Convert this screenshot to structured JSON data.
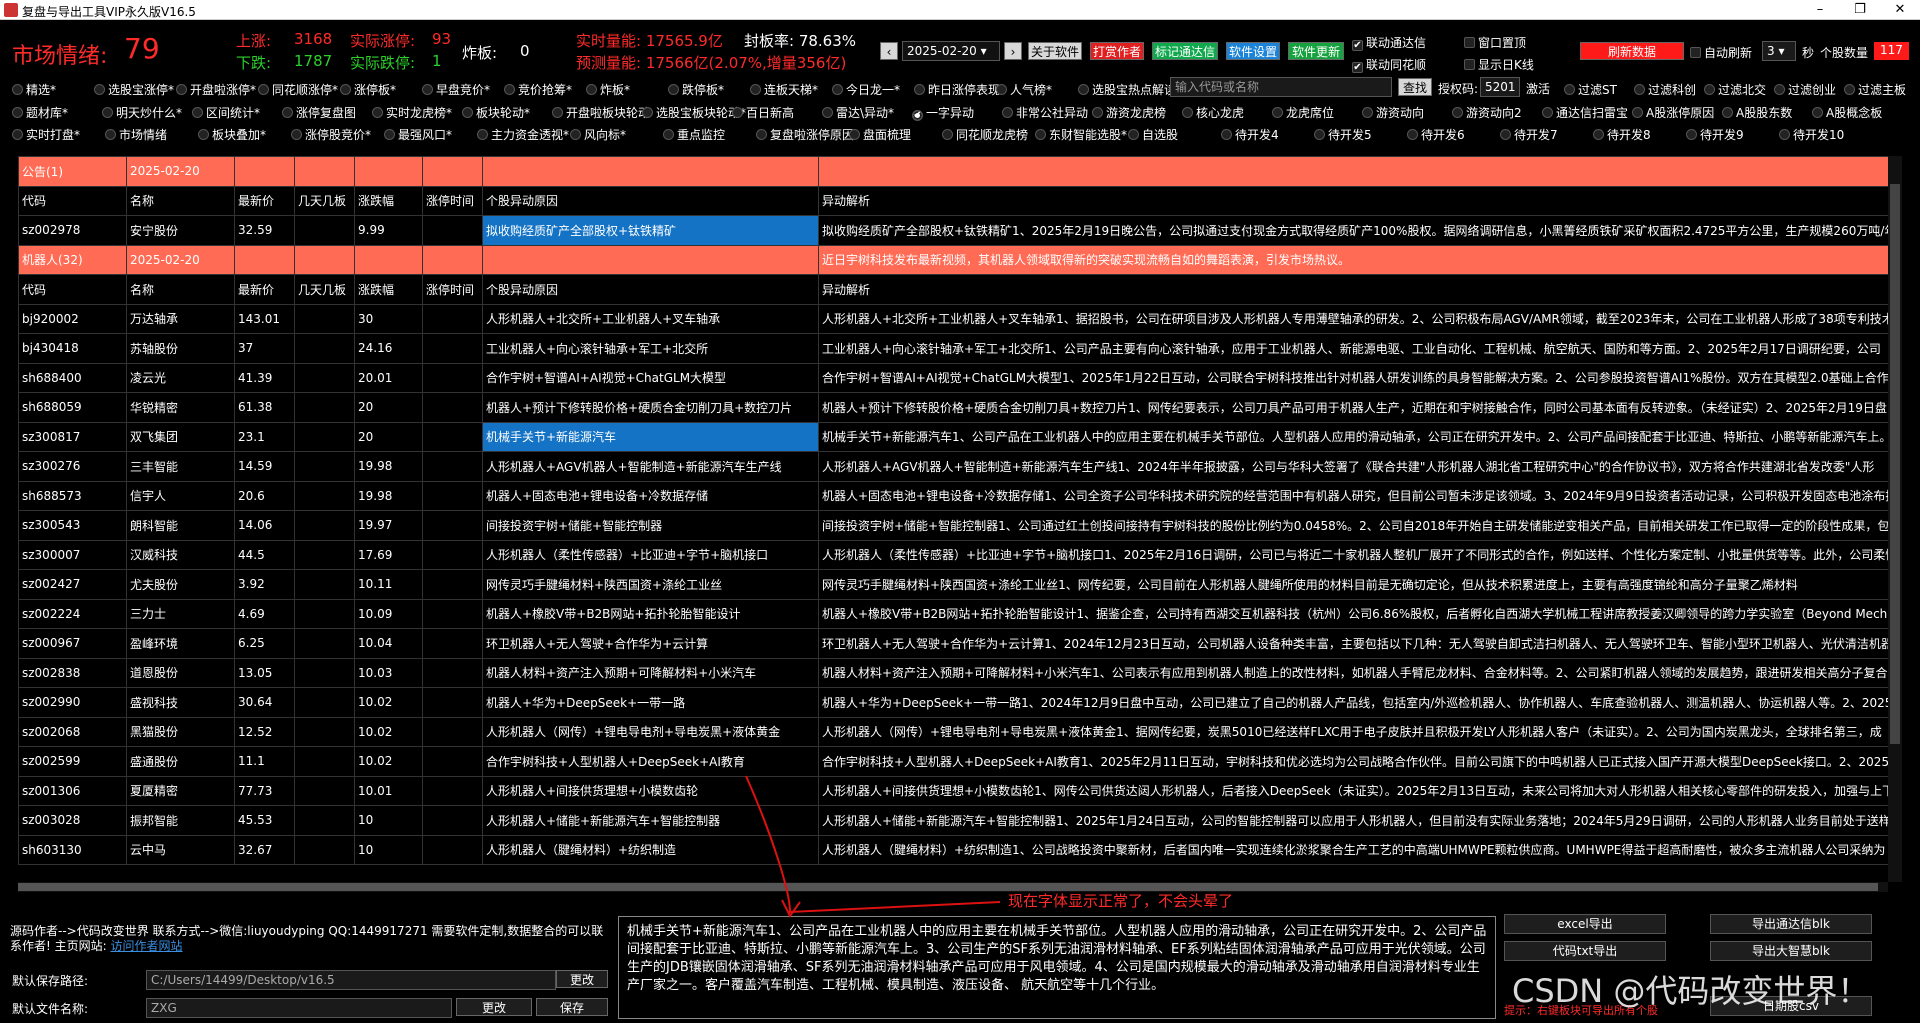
{
  "window": {
    "title": "复盘与导出工具VIP永久版V16.5"
  },
  "header": {
    "market_label": "市场情绪:",
    "market_value": "79",
    "up_label": "上涨:",
    "up_value": "3168",
    "down_label": "下跌:",
    "down_value": "1787",
    "limit_up_label": "实际涨停:",
    "limit_up_value": "93",
    "limit_down_label": "实际跌停:",
    "limit_down_value": "1",
    "broken_label": "炸板:",
    "broken_value": "0",
    "volume_now": "实时量能: 17565.9亿",
    "seal_rate": "封板率: 78.63%",
    "volume_forecast": "预测量能: 17566亿(2.07%,增量356亿)",
    "date": "2025-02-20",
    "btn_about": "关于软件",
    "btn_reward": "打赏作者",
    "btn_mark": "标记通达信",
    "btn_settings": "软件设置",
    "btn_update": "软件更新",
    "chk_tdx": "联动通达信",
    "chk_ths": "联动同花顺",
    "chk_top": "窗口置顶",
    "chk_kline": "显示日K线",
    "btn_refresh": "刷新数据",
    "auto_refresh": "自动刷新",
    "interval": "3",
    "sec": "秒",
    "count_label": "个股数量",
    "count_value": "117"
  },
  "filters": {
    "row1": [
      "精选*",
      "选股宝涨停*",
      "开盘啦涨停*",
      "同花顺涨停*",
      "涨停板*",
      "早盘竞价*",
      "竞价抢筹*",
      "炸板*",
      "跌停板*",
      "连板天梯*",
      "今日龙一*",
      "昨日涨停表现*",
      "人气榜*",
      "选股宝热点解读*"
    ],
    "search_placeholder": "输入代码或名称",
    "search_btn": "查找",
    "auth_label": "授权码:",
    "auth_value": "5201",
    "activate": "激活",
    "row1_right": [
      "过滤ST",
      "过滤科创",
      "过滤北交",
      "过滤创业",
      "过滤主板"
    ],
    "row2": [
      "题材库*",
      "明天炒什么*",
      "区间统计*",
      "涨停复盘图",
      "实时龙虎榜*",
      "板块轮动*",
      "开盘啦板块轮动",
      "选股宝板块轮动*",
      "百日新高",
      "雷达\\异动*",
      "一字异动",
      "非常公社异动",
      "游资龙虎榜",
      "核心龙虎",
      "龙虎席位",
      "游资动向",
      "游资动向2",
      "通达信扫雷宝",
      "A股涨停原因",
      "A股股东数",
      "A股概念板"
    ],
    "row3": [
      "实时打盘*",
      "市场情绪",
      "板块叠加*",
      "涨停股竞价*",
      "最强风口*",
      "主力资金透视*",
      "风向标*",
      "重点监控",
      "复盘啦涨停原因",
      "盘面梳理",
      "同花顺龙虎榜",
      "东财智能选股*",
      "自选股",
      "待开发4",
      "待开发5",
      "待开发6",
      "待开发7",
      "待开发8",
      "待开发9",
      "待开发10"
    ]
  },
  "table": {
    "headers": [
      "代码",
      "名称",
      "最新价",
      "几天几板",
      "涨跌幅",
      "涨停时间",
      "个股异动原因",
      "异动解析"
    ],
    "rows": [
      {
        "type": "group",
        "c": [
          "公告(1)",
          "2025-02-20",
          "",
          "",
          "",
          "",
          "",
          ""
        ]
      },
      {
        "type": "header"
      },
      {
        "type": "data",
        "sel": true,
        "c": [
          "sz002978",
          "安宁股份",
          "32.59",
          "",
          "9.99",
          "",
          "拟收购经质矿产全部股权+钛铁精矿",
          "拟收购经质矿产全部股权+钛铁精矿1、2025年2月19日晚公告，公司拟通过支付现金方式取得经质矿产100%股权。据网络调研信息，小黑箐经质铁矿采矿权面积2.4725平方公里，生产规模260万吨/年"
        ]
      },
      {
        "type": "group",
        "c": [
          "机器人(32)",
          "2025-02-20",
          "",
          "",
          "",
          "",
          "",
          "近日宇树科技发布最新视频，其机器人领域取得新的突破实现流畅自如的舞蹈表演，引发市场热议。"
        ]
      },
      {
        "type": "header"
      },
      {
        "type": "data",
        "c": [
          "bj920002",
          "万达轴承",
          "143.01",
          "",
          "30",
          "",
          "人形机器人+北交所+工业机器人+叉车轴承",
          "人形机器人+北交所+工业机器人+叉车轴承1、据招股书，公司在研项目涉及人形机器人专用薄壁轴承的研发。2、公司积极布局AGV/AMR领域，截至2023年末，公司在工业机器人形成了38项专利技术"
        ]
      },
      {
        "type": "data",
        "c": [
          "bj430418",
          "苏轴股份",
          "37",
          "",
          "24.16",
          "",
          "工业机器人+向心滚针轴承+军工+北交所",
          "工业机器人+向心滚针轴承+军工+北交所1、公司产品主要有向心滚针轴承，应用于工业机器人、新能源电驱、工业自动化、工程机械、航空航天、国防和等方面。2、2025年2月17日调研纪要，公司"
        ]
      },
      {
        "type": "data",
        "c": [
          "sh688400",
          "凌云光",
          "41.39",
          "",
          "20.01",
          "",
          "合作宇树+智谱AI+AI视觉+ChatGLM大模型",
          "合作宇树+智谱AI+AI视觉+ChatGLM大模型1、2025年1月22日互动，公司联合宇树科技推出针对机器人研发训练的具身智能解决方案。2、公司参股投资智谱AI1%股份。双方在其模型2.0基础上合作开"
        ]
      },
      {
        "type": "data",
        "c": [
          "sh688059",
          "华锐精密",
          "61.38",
          "",
          "20",
          "",
          "机器人+预计下修转股价格+硬质合金切削刀具+数控刀片",
          "机器人+预计下修转股价格+硬质合金切削刀具+数控刀片1、网传纪要表示，公司刀具产品可用于机器人生产，近期在和宇树接触合作，同时公司基本面有反转迹象。（未经证实）2、2025年2月19日盘"
        ]
      },
      {
        "type": "data",
        "sel": true,
        "c": [
          "sz300817",
          "双飞集团",
          "23.1",
          "",
          "20",
          "",
          "机械手关节+新能源汽车",
          "机械手关节+新能源汽车1、公司产品在工业机器人中的应用主要在机械手关节部位。人型机器人应用的滑动轴承，公司正在研究开发中。2、公司产品间接配套于比亚迪、特斯拉、小鹏等新能源汽车上。"
        ]
      },
      {
        "type": "data",
        "c": [
          "sz300276",
          "三丰智能",
          "14.59",
          "",
          "19.98",
          "",
          "人形机器人+AGV机器人+智能制造+新能源汽车生产线",
          "人形机器人+AGV机器人+智能制造+新能源汽车生产线1、2024年半年报披露，公司与华科大签署了《联合共建\"人形机器人湖北省工程研究中心\"的合作协议书》，双方将合作共建湖北省发改委\"人形"
        ]
      },
      {
        "type": "data",
        "c": [
          "sh688573",
          "信宇人",
          "20.6",
          "",
          "19.98",
          "",
          "机器人+固态电池+锂电设备+冷数据存储",
          "机器人+固态电池+锂电设备+冷数据存储1、公司全资子公司华科技术研究院的经营范围中有机器人研究，但目前公司暂未涉足该领域。3、2024年9月9日投资者活动记录，公司积极开发固态电池涂布技"
        ]
      },
      {
        "type": "data",
        "c": [
          "sz300543",
          "朗科智能",
          "14.06",
          "",
          "19.97",
          "",
          "间接投资宇树+储能+智能控制器",
          "间接投资宇树+储能+智能控制器1、公司通过红土创投间接持有宇树科技的股份比例约为0.0458%。2、公司自2018年开始自主研发储能逆变相关产品，目前相关研发工作已取得一定的阶段性成果，包"
        ]
      },
      {
        "type": "data",
        "c": [
          "sz300007",
          "汉威科技",
          "44.5",
          "",
          "17.69",
          "",
          "人形机器人（柔性传感器）+比亚迪+字节+脑机接口",
          "人形机器人（柔性传感器）+比亚迪+字节+脑机接口1、2025年2月16日调研，公司已与将近二十家机器人整机厂展开了不同形式的合作，例如送样、个性化方案定制、小批量供货等等。此外，公司柔性"
        ]
      },
      {
        "type": "data",
        "c": [
          "sz002427",
          "尤夫股份",
          "3.92",
          "",
          "10.11",
          "",
          "网传灵巧手腱绳材料+陕西国资+涤纶工业丝",
          "网传灵巧手腱绳材料+陕西国资+涤纶工业丝1、网传纪要，公司目前在人形机器人腱绳所使用的材料目前是无确切定论，但从技术积累进度上，主要有高强度锦纶和高分子量聚乙烯材料"
        ]
      },
      {
        "type": "data",
        "c": [
          "sz002224",
          "三力士",
          "4.69",
          "",
          "10.09",
          "",
          "机器人+橡胶V带+B2B网站+拓扑轮胎智能设计",
          "机器人+橡胶V带+B2B网站+拓扑轮胎智能设计1、据鉴企查，公司持有西湖交互机器科技（杭州）公司6.86%股权，后者孵化自西湖大学机械工程讲席教授姜汉卿领导的跨力学实验室（Beyond Mecha"
        ]
      },
      {
        "type": "data",
        "c": [
          "sz000967",
          "盈峰环境",
          "6.25",
          "",
          "10.04",
          "",
          "环卫机器人+无人驾驶+合作华为+云计算",
          "环卫机器人+无人驾驶+合作华为+云计算1、2024年12月23日互动，公司机器人设备种类丰富，主要包括以下几种：无人驾驶自卸式洁扫机器人、无人驾驶环卫车、智能小型环卫机器人、光伏清洁机器"
        ]
      },
      {
        "type": "data",
        "c": [
          "sz002838",
          "道恩股份",
          "13.05",
          "",
          "10.03",
          "",
          "机器人材料+资产注入预期+可降解材料+小米汽车",
          "机器人材料+资产注入预期+可降解材料+小米汽车1、公司表示有应用到机器人制造上的改性材料，如机器人手臂尼龙材料、合金材料等。2、公司紧盯机器人领域的发展趋势，跟进研发相关高分子复合材料"
        ]
      },
      {
        "type": "data",
        "c": [
          "sz002990",
          "盛视科技",
          "30.64",
          "",
          "10.02",
          "",
          "机器人+华为+DeepSeek+一带一路",
          "机器人+华为+DeepSeek+一带一路1、2024年12月9日盘中互动，公司已建立了自己的机器人产品线，包括室内/外巡检机器人、协作机器人、车底查验机器人、测温机器人、协运机器人等。2、2025年"
        ]
      },
      {
        "type": "data",
        "c": [
          "sz002068",
          "黑猫股份",
          "12.52",
          "",
          "10.02",
          "",
          "人形机器人（网传）+锂电导电剂+导电炭黑+液体黄金",
          "人形机器人（网传）+锂电导电剂+导电炭黑+液体黄金1、据网传纪要，炭黑5010已经送样FLXC用于电子皮肤并且积极开发LY人形机器人客户（未证实）。2、公司为国内炭黑龙头，全球排名第三，成"
        ]
      },
      {
        "type": "data",
        "c": [
          "sz002599",
          "盛通股份",
          "11.1",
          "",
          "10.02",
          "",
          "合作宇树科技+人型机器人+DeepSeek+AI教育",
          "合作宇树科技+人型机器人+DeepSeek+AI教育1、2025年2月11日互动，宇树科技和优必选均为公司战略合作伙伴。目前公司旗下的中鸣机器人已正式接入国产开源大模型DeepSeek接口。2、2025年"
        ]
      },
      {
        "type": "data",
        "c": [
          "sz001306",
          "夏厦精密",
          "77.73",
          "",
          "10.01",
          "",
          "人形机器人+间接供货理想+小模数齿轮",
          "人形机器人+间接供货理想+小模数齿轮1、网传公司供货达闼人形机器人，后者接入DeepSeek（未证实）。2025年2月13日互动，未来公司将加大对人形机器人相关核心零部件的研发投入，加强与上下"
        ]
      },
      {
        "type": "data",
        "c": [
          "sz003028",
          "振邦智能",
          "45.53",
          "",
          "10",
          "",
          "人形机器人+储能+新能源汽车+智能控制器",
          "人形机器人+储能+新能源汽车+智能控制器1、2025年1月24日互动，公司的智能控制器可以应用于人形机器人，但目前没有实际业务落地；2024年5月29日调研，公司的人形机器人业务目前处于送样阶"
        ]
      },
      {
        "type": "data",
        "c": [
          "sh603130",
          "云中马",
          "32.67",
          "",
          "10",
          "",
          "人形机器人（腱绳材料）+纺织制造",
          "人形机器人（腱绳材料）+纺织制造1、公司战略投资中聚新材，后者国内唯一实现连续化淤浆聚合生产工艺的中高端UHMWPE颗粒供应商。UMHWPE得益于超高耐磨性，被众多主流机器人公司采纳为"
        ]
      }
    ]
  },
  "bottom": {
    "author_line": "源码作者-->代码改变世界 联系方式-->微信:liuyoudyping QQ:1449917271 需要软件定制,数据整合的可以联系作者! 主页网站:",
    "author_link": "访问作者网站",
    "save_path_label": "默认保存路径:",
    "save_path": "C:/Users/14499/Desktop/v16.5",
    "change_btn": "更改",
    "filename_label": "默认文件名称:",
    "filename": "ZXG",
    "change_btn2": "更改",
    "save_btn": "保存",
    "detail_text": "机械手关节+新能源汽车1、公司产品在工业机器人中的应用主要在机械手关节部位。人型机器人应用的滑动轴承，公司正在研究开发中。2、公司产品间接配套于比亚迪、特斯拉、小鹏等新能源汽车上。3、公司生产的SF系列无油润滑材料轴承、EF系列粘结固体润滑轴承产品可应用于光伏领域。公司生产的JDB镶嵌固体润滑轴承、SF系列无油润滑材料轴承产品可应用于风电领域。4、公司是国内规模最大的滑动轴承及滑动轴承用自润滑材料专业生产厂家之一。客户覆盖汽车制造、工程机械、模具制造、液压设备、 航天航空等十几个行业。",
    "annotation": "现在字体显示正常了，不会头晕了",
    "export_excel": "excel导出",
    "export_tdx": "导出通达信blk",
    "export_txt": "代码txt导出",
    "export_dzh": "导出大智慧blk",
    "export_csv": "日期股csv",
    "hint": "提示：右键板块可导出所有个股",
    "watermark": "CSDN @代码改变世界！"
  }
}
